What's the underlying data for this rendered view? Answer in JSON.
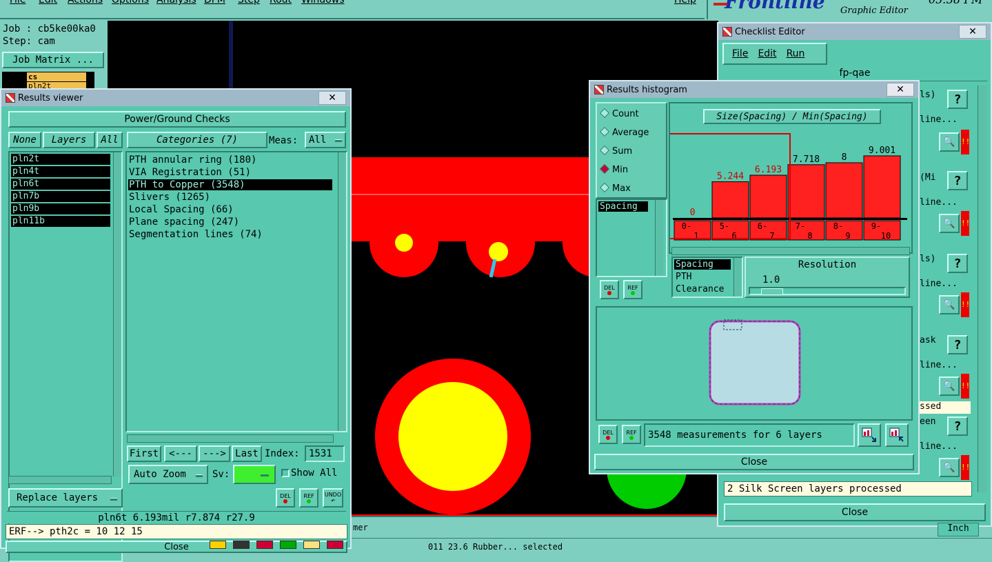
{
  "menubar": {
    "items": [
      "File",
      "Edit",
      "Actions",
      "Options",
      "Analysis",
      "DFM",
      "Step",
      "Rout",
      "Windows"
    ],
    "help": "Help"
  },
  "logo": {
    "brand": "Frontline",
    "subtitle": "Graphic Editor",
    "clock": "05:38 PM"
  },
  "job_panel": {
    "job": "Job : cb5ke00ka0",
    "step": "Step: cam",
    "job_matrix": "Job Matrix ...",
    "layer_a": "cs",
    "layer_b": "pln2t"
  },
  "results_viewer": {
    "title": "Results viewer",
    "header": "Power/Ground Checks",
    "none_btn": "None",
    "layers_btn": "Layers",
    "all_btn": "All",
    "categories_btn": "Categories (7)",
    "meas_label": "Meas:",
    "meas_value": "All",
    "layers": [
      "pln2t",
      "pln4t",
      "pln6t",
      "pln7b",
      "pln9b",
      "pln11b"
    ],
    "categories": [
      "PTH annular ring (180)",
      "VIA Registration (51)",
      "PTH to Copper (3548)",
      "Slivers (1265)",
      "Local Spacing (66)",
      "Plane spacing (247)",
      "Segmentation lines (74)"
    ],
    "selected_category": 2,
    "first_btn": "First",
    "prev_btn": "<---",
    "next_btn": "--->",
    "last_btn": "Last",
    "index_label": "Index:",
    "index_value": "1531",
    "autozoom": "Auto Zoom",
    "sv_label": "Sv:",
    "show_all": "Show All",
    "replace_layers": "Replace layers",
    "del": "DEL",
    "ref": "REF",
    "undo": "UNDO",
    "status": "pln6t  6.193mil  r7.874  r27.9",
    "erf": "ERF--> pth2c = 10 12 15",
    "close": "Close"
  },
  "histogram": {
    "title": "Results histogram",
    "modes": [
      "Count",
      "Average",
      "Sum",
      "Min",
      "Max"
    ],
    "selected_mode": "Min",
    "chart_title": "Size(Spacing) / Min(Spacing)",
    "list_item": "Spacing",
    "types": [
      "Spacing",
      "PTH",
      "Clearance"
    ],
    "resolution_label": "Resolution",
    "resolution_value": "1.0",
    "del": "DEL",
    "ref": "REF",
    "summary": "3548 measurements for 6 layers",
    "close": "Close"
  },
  "chart_data": {
    "type": "bar",
    "title": "Size(Spacing) / Min(Spacing)",
    "categories": [
      "0-1",
      "5-6",
      "6-7",
      "7-8",
      "8-9",
      "9-10"
    ],
    "values": [
      0,
      5.244,
      6.193,
      7.718,
      8,
      9.001
    ],
    "value_labels": [
      "0",
      "5.244",
      "6.193",
      "7.718",
      "8",
      "9.001"
    ],
    "ylim": [
      0,
      10
    ],
    "colors": {
      "bar": "#ff2020",
      "highlight_label": "#d00000",
      "normal_label": "#000000"
    }
  },
  "checklist": {
    "title": "Checklist Editor",
    "menu": [
      "File",
      "Edit",
      "Run"
    ],
    "checklist_name": "fp-qae",
    "row_fragments": [
      "ls)",
      "(Mi",
      "ls)",
      "ask",
      "een"
    ],
    "line_fragment": "line...",
    "processed_fragment": "ssed",
    "silk_status": "2 Silk Screen layers processed",
    "close": "Close",
    "inch_fragment": "Inch"
  },
  "canvas": {
    "status_fragment": "mer",
    "bottom_fragment": "011   23.6  Rubber... selected"
  }
}
